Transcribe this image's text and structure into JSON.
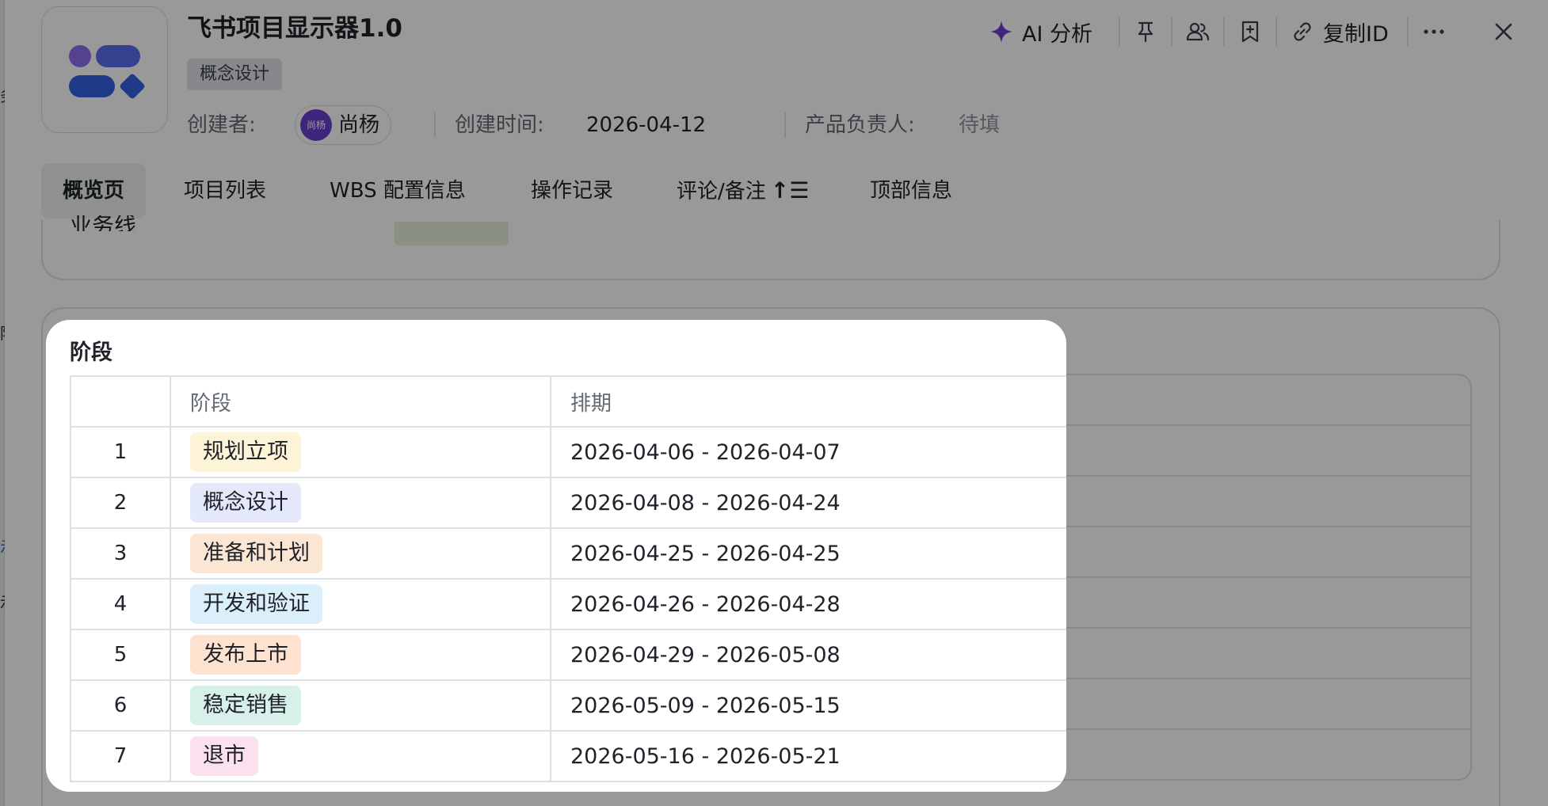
{
  "header": {
    "title": "飞书项目显示器1.0",
    "tag": "概念设计",
    "creator_label": "创建者:",
    "creator_avatar_text": "尚杨",
    "creator_name": "尚杨",
    "created_label": "创建时间:",
    "created_value": "2026-04-12",
    "owner_label": "产品负责人:",
    "owner_value": "待填"
  },
  "toolbar": {
    "ai_label": "AI 分析",
    "copy_id_label": "复制ID",
    "icons": [
      "sparkle-icon",
      "pin-icon",
      "people-icon",
      "bookmark-add-icon",
      "link-icon",
      "more-icon",
      "close-icon"
    ]
  },
  "tabs": [
    {
      "label": "概览页",
      "active": true
    },
    {
      "label": "项目列表"
    },
    {
      "label": "WBS 配置信息"
    },
    {
      "label": "操作记录"
    },
    {
      "label": "评论/备注",
      "sort_glyph": "↑☰"
    },
    {
      "label": "顶部信息"
    }
  ],
  "stages_popup": {
    "title": "阶段",
    "columns": [
      "",
      "阶段",
      "排期"
    ],
    "rows": [
      {
        "index": "1",
        "stage": "规划立项",
        "schedule": "2026-04-06 - 2026-04-07",
        "color": "#fdf3d6"
      },
      {
        "index": "2",
        "stage": "概念设计",
        "schedule": "2026-04-08 - 2026-04-24",
        "color": "#e4e8fb"
      },
      {
        "index": "3",
        "stage": "准备和计划",
        "schedule": "2026-04-25 - 2026-04-25",
        "color": "#fbe6d3"
      },
      {
        "index": "4",
        "stage": "开发和验证",
        "schedule": "2026-04-26 - 2026-04-28",
        "color": "#dbeffb"
      },
      {
        "index": "5",
        "stage": "发布上市",
        "schedule": "2026-04-29 - 2026-05-08",
        "color": "#fde2d0"
      },
      {
        "index": "6",
        "stage": "稳定销售",
        "schedule": "2026-05-09 - 2026-05-15",
        "color": "#d7f1ea"
      },
      {
        "index": "7",
        "stage": "退市",
        "schedule": "2026-05-16 - 2026-05-21",
        "color": "#fbe0ef"
      }
    ]
  },
  "colors": {
    "accent_purple": "#6d3fd1",
    "logo_blue": "#3561e0",
    "logo_purple": "#8c6ff0",
    "overlay": "rgba(0,0,0,0.40)"
  }
}
